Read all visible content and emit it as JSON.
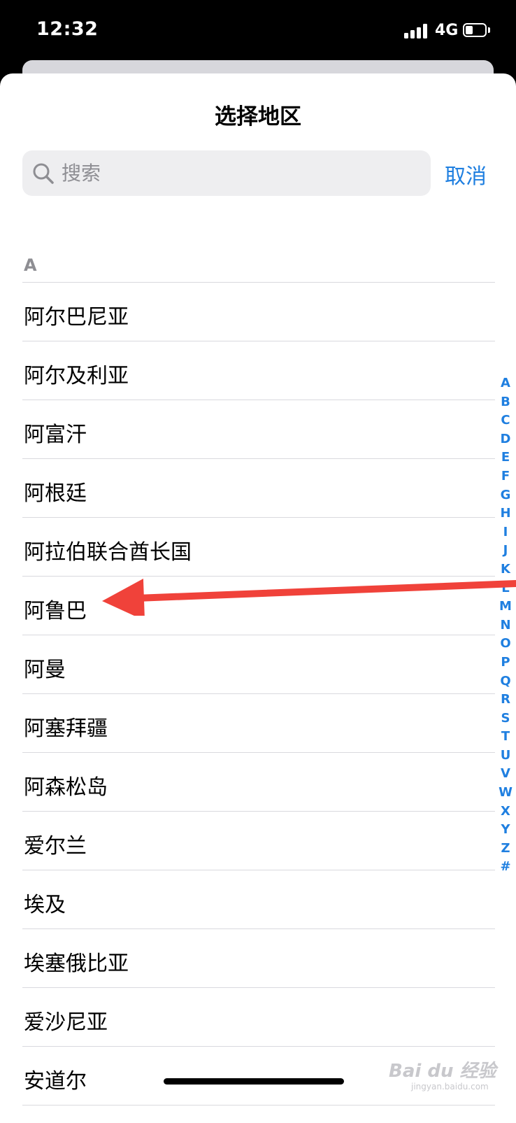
{
  "status_bar": {
    "time": "12:32",
    "network": "4G"
  },
  "sheet": {
    "title": "选择地区"
  },
  "search": {
    "placeholder": "搜索",
    "cancel_label": "取消"
  },
  "section": {
    "header": "A"
  },
  "regions": [
    "阿尔巴尼亚",
    "阿尔及利亚",
    "阿富汗",
    "阿根廷",
    "阿拉伯联合酋长国",
    "阿鲁巴",
    "阿曼",
    "阿塞拜疆",
    "阿森松岛",
    "爱尔兰",
    "埃及",
    "埃塞俄比亚",
    "爱沙尼亚",
    "安道尔"
  ],
  "index_letters": [
    "A",
    "B",
    "C",
    "D",
    "E",
    "F",
    "G",
    "H",
    "I",
    "J",
    "K",
    "L",
    "M",
    "N",
    "O",
    "P",
    "Q",
    "R",
    "S",
    "T",
    "U",
    "V",
    "W",
    "X",
    "Y",
    "Z",
    "#"
  ],
  "watermark": {
    "brand": "Bai du 经验",
    "site": "jingyan.baidu.com"
  },
  "colors": {
    "accent": "#1f7fe0",
    "arrow": "#f0423a"
  }
}
